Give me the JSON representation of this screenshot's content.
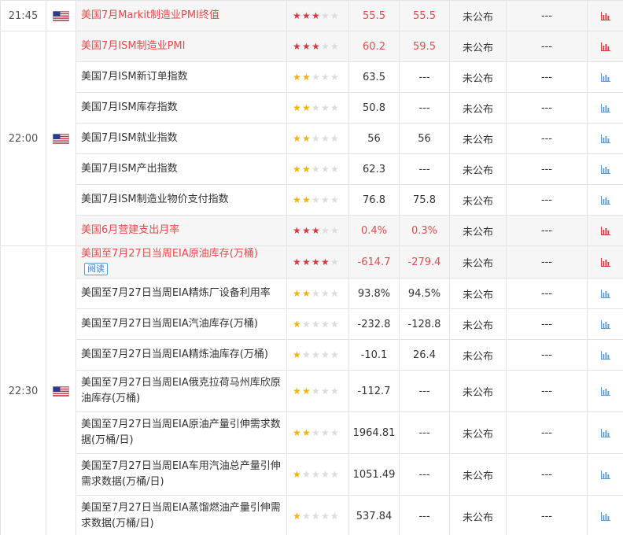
{
  "status_text": "未公布",
  "na_text": "---",
  "read_label": "阅读",
  "colors": {
    "highlight_text": "#e84a4a",
    "star_red": "#d9363e",
    "star_yellow": "#f4b400",
    "chart_blue": "#5b9bd5",
    "chart_red": "#d9363e"
  },
  "groups": [
    {
      "time": "21:45",
      "country_icon": "us-flag-icon",
      "rows": [
        {
          "name": "美国7月Markit制造业PMI终值",
          "importance": 3,
          "prior": "55.5",
          "forecast": "55.5",
          "actual": "未公布",
          "impact": "---",
          "highlight": true
        }
      ]
    },
    {
      "time": "22:00",
      "country_icon": "us-flag-icon",
      "rows": [
        {
          "name": "美国7月ISM制造业PMI",
          "importance": 3,
          "prior": "60.2",
          "forecast": "59.5",
          "actual": "未公布",
          "impact": "---",
          "highlight": true
        },
        {
          "name": "美国7月ISM新订单指数",
          "importance": 2,
          "prior": "63.5",
          "forecast": "---",
          "actual": "未公布",
          "impact": "---",
          "highlight": false
        },
        {
          "name": "美国7月ISM库存指数",
          "importance": 2,
          "prior": "50.8",
          "forecast": "---",
          "actual": "未公布",
          "impact": "---",
          "highlight": false
        },
        {
          "name": "美国7月ISM就业指数",
          "importance": 2,
          "prior": "56",
          "forecast": "56",
          "actual": "未公布",
          "impact": "---",
          "highlight": false
        },
        {
          "name": "美国7月ISM产出指数",
          "importance": 2,
          "prior": "62.3",
          "forecast": "---",
          "actual": "未公布",
          "impact": "---",
          "highlight": false
        },
        {
          "name": "美国7月ISM制造业物价支付指数",
          "importance": 2,
          "prior": "76.8",
          "forecast": "75.8",
          "actual": "未公布",
          "impact": "---",
          "highlight": false
        },
        {
          "name": "美国6月营建支出月率",
          "importance": 3,
          "prior": "0.4%",
          "forecast": "0.3%",
          "actual": "未公布",
          "impact": "---",
          "highlight": true
        }
      ]
    },
    {
      "time": "22:30",
      "country_icon": "us-flag-icon",
      "rows": [
        {
          "name": "美国至7月27日当周EIA原油库存(万桶)",
          "importance": 4,
          "prior": "-614.7",
          "forecast": "-279.4",
          "actual": "未公布",
          "impact": "---",
          "highlight": true,
          "read": true
        },
        {
          "name": "美国至7月27日当周EIA精炼厂设备利用率",
          "importance": 2,
          "prior": "93.8%",
          "forecast": "94.5%",
          "actual": "未公布",
          "impact": "---",
          "highlight": false
        },
        {
          "name": "美国至7月27日当周EIA汽油库存(万桶)",
          "importance": 1,
          "prior": "-232.8",
          "forecast": "-128.8",
          "actual": "未公布",
          "impact": "---",
          "highlight": false
        },
        {
          "name": "美国至7月27日当周EIA精炼油库存(万桶)",
          "importance": 1,
          "prior": "-10.1",
          "forecast": "26.4",
          "actual": "未公布",
          "impact": "---",
          "highlight": false
        },
        {
          "name": "美国至7月27日当周EIA俄克拉荷马州库欣原油库存(万桶)",
          "importance": 2,
          "prior": "-112.7",
          "forecast": "---",
          "actual": "未公布",
          "impact": "---",
          "highlight": false,
          "tall": true
        },
        {
          "name": "美国至7月27日当周EIA原油产量引伸需求数据(万桶/日)",
          "importance": 2,
          "prior": "1964.81",
          "forecast": "---",
          "actual": "未公布",
          "impact": "---",
          "highlight": false,
          "tall": true
        },
        {
          "name": "美国至7月27日当周EIA车用汽油总产量引伸需求数据(万桶/日)",
          "importance": 1,
          "prior": "1051.49",
          "forecast": "---",
          "actual": "未公布",
          "impact": "---",
          "highlight": false,
          "tall": true
        },
        {
          "name": "美国至7月27日当周EIA蒸馏燃油产量引伸需求数据(万桶/日)",
          "importance": 1,
          "prior": "537.84",
          "forecast": "---",
          "actual": "未公布",
          "impact": "---",
          "highlight": false,
          "tall": true
        }
      ]
    }
  ]
}
